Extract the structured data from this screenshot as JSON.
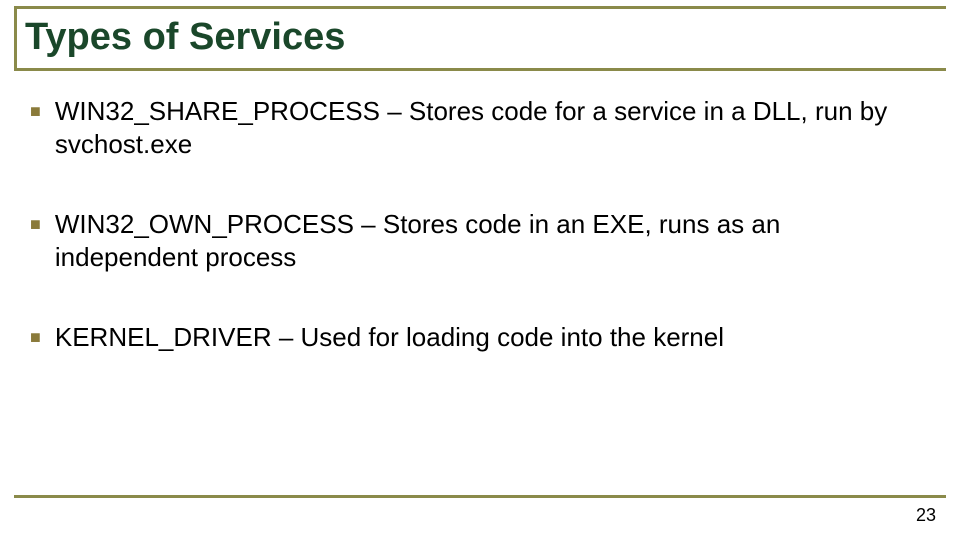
{
  "slide": {
    "title": "Types of Services",
    "bullets": [
      "WIN32_SHARE_PROCESS – Stores code for a service in a DLL, run by svchost.exe",
      "WIN32_OWN_PROCESS – Stores code in an EXE, runs as an independent process",
      "KERNEL_DRIVER – Used for loading code into the kernel"
    ],
    "page_number": "23"
  }
}
